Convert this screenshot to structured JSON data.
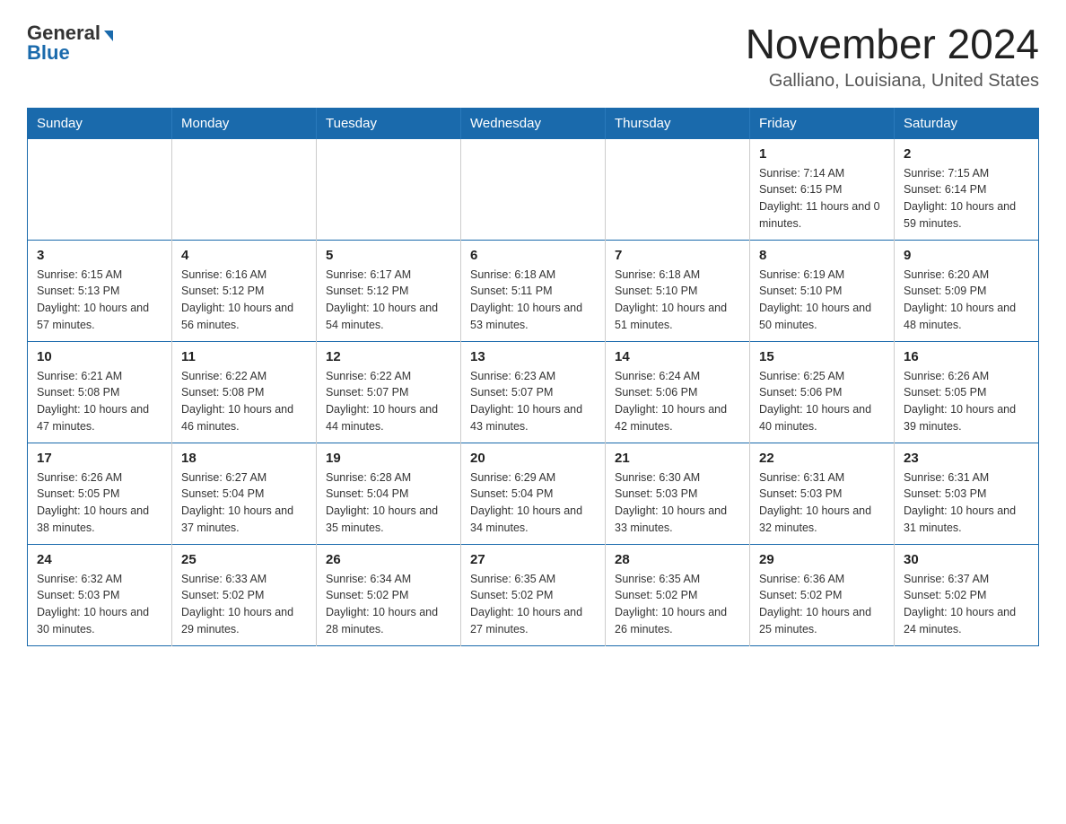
{
  "header": {
    "logo_general": "General",
    "logo_blue": "Blue",
    "month_title": "November 2024",
    "location": "Galliano, Louisiana, United States"
  },
  "days_of_week": [
    "Sunday",
    "Monday",
    "Tuesday",
    "Wednesday",
    "Thursday",
    "Friday",
    "Saturday"
  ],
  "weeks": [
    [
      {
        "day": "",
        "sunrise": "",
        "sunset": "",
        "daylight": ""
      },
      {
        "day": "",
        "sunrise": "",
        "sunset": "",
        "daylight": ""
      },
      {
        "day": "",
        "sunrise": "",
        "sunset": "",
        "daylight": ""
      },
      {
        "day": "",
        "sunrise": "",
        "sunset": "",
        "daylight": ""
      },
      {
        "day": "",
        "sunrise": "",
        "sunset": "",
        "daylight": ""
      },
      {
        "day": "1",
        "sunrise": "Sunrise: 7:14 AM",
        "sunset": "Sunset: 6:15 PM",
        "daylight": "Daylight: 11 hours and 0 minutes."
      },
      {
        "day": "2",
        "sunrise": "Sunrise: 7:15 AM",
        "sunset": "Sunset: 6:14 PM",
        "daylight": "Daylight: 10 hours and 59 minutes."
      }
    ],
    [
      {
        "day": "3",
        "sunrise": "Sunrise: 6:15 AM",
        "sunset": "Sunset: 5:13 PM",
        "daylight": "Daylight: 10 hours and 57 minutes."
      },
      {
        "day": "4",
        "sunrise": "Sunrise: 6:16 AM",
        "sunset": "Sunset: 5:12 PM",
        "daylight": "Daylight: 10 hours and 56 minutes."
      },
      {
        "day": "5",
        "sunrise": "Sunrise: 6:17 AM",
        "sunset": "Sunset: 5:12 PM",
        "daylight": "Daylight: 10 hours and 54 minutes."
      },
      {
        "day": "6",
        "sunrise": "Sunrise: 6:18 AM",
        "sunset": "Sunset: 5:11 PM",
        "daylight": "Daylight: 10 hours and 53 minutes."
      },
      {
        "day": "7",
        "sunrise": "Sunrise: 6:18 AM",
        "sunset": "Sunset: 5:10 PM",
        "daylight": "Daylight: 10 hours and 51 minutes."
      },
      {
        "day": "8",
        "sunrise": "Sunrise: 6:19 AM",
        "sunset": "Sunset: 5:10 PM",
        "daylight": "Daylight: 10 hours and 50 minutes."
      },
      {
        "day": "9",
        "sunrise": "Sunrise: 6:20 AM",
        "sunset": "Sunset: 5:09 PM",
        "daylight": "Daylight: 10 hours and 48 minutes."
      }
    ],
    [
      {
        "day": "10",
        "sunrise": "Sunrise: 6:21 AM",
        "sunset": "Sunset: 5:08 PM",
        "daylight": "Daylight: 10 hours and 47 minutes."
      },
      {
        "day": "11",
        "sunrise": "Sunrise: 6:22 AM",
        "sunset": "Sunset: 5:08 PM",
        "daylight": "Daylight: 10 hours and 46 minutes."
      },
      {
        "day": "12",
        "sunrise": "Sunrise: 6:22 AM",
        "sunset": "Sunset: 5:07 PM",
        "daylight": "Daylight: 10 hours and 44 minutes."
      },
      {
        "day": "13",
        "sunrise": "Sunrise: 6:23 AM",
        "sunset": "Sunset: 5:07 PM",
        "daylight": "Daylight: 10 hours and 43 minutes."
      },
      {
        "day": "14",
        "sunrise": "Sunrise: 6:24 AM",
        "sunset": "Sunset: 5:06 PM",
        "daylight": "Daylight: 10 hours and 42 minutes."
      },
      {
        "day": "15",
        "sunrise": "Sunrise: 6:25 AM",
        "sunset": "Sunset: 5:06 PM",
        "daylight": "Daylight: 10 hours and 40 minutes."
      },
      {
        "day": "16",
        "sunrise": "Sunrise: 6:26 AM",
        "sunset": "Sunset: 5:05 PM",
        "daylight": "Daylight: 10 hours and 39 minutes."
      }
    ],
    [
      {
        "day": "17",
        "sunrise": "Sunrise: 6:26 AM",
        "sunset": "Sunset: 5:05 PM",
        "daylight": "Daylight: 10 hours and 38 minutes."
      },
      {
        "day": "18",
        "sunrise": "Sunrise: 6:27 AM",
        "sunset": "Sunset: 5:04 PM",
        "daylight": "Daylight: 10 hours and 37 minutes."
      },
      {
        "day": "19",
        "sunrise": "Sunrise: 6:28 AM",
        "sunset": "Sunset: 5:04 PM",
        "daylight": "Daylight: 10 hours and 35 minutes."
      },
      {
        "day": "20",
        "sunrise": "Sunrise: 6:29 AM",
        "sunset": "Sunset: 5:04 PM",
        "daylight": "Daylight: 10 hours and 34 minutes."
      },
      {
        "day": "21",
        "sunrise": "Sunrise: 6:30 AM",
        "sunset": "Sunset: 5:03 PM",
        "daylight": "Daylight: 10 hours and 33 minutes."
      },
      {
        "day": "22",
        "sunrise": "Sunrise: 6:31 AM",
        "sunset": "Sunset: 5:03 PM",
        "daylight": "Daylight: 10 hours and 32 minutes."
      },
      {
        "day": "23",
        "sunrise": "Sunrise: 6:31 AM",
        "sunset": "Sunset: 5:03 PM",
        "daylight": "Daylight: 10 hours and 31 minutes."
      }
    ],
    [
      {
        "day": "24",
        "sunrise": "Sunrise: 6:32 AM",
        "sunset": "Sunset: 5:03 PM",
        "daylight": "Daylight: 10 hours and 30 minutes."
      },
      {
        "day": "25",
        "sunrise": "Sunrise: 6:33 AM",
        "sunset": "Sunset: 5:02 PM",
        "daylight": "Daylight: 10 hours and 29 minutes."
      },
      {
        "day": "26",
        "sunrise": "Sunrise: 6:34 AM",
        "sunset": "Sunset: 5:02 PM",
        "daylight": "Daylight: 10 hours and 28 minutes."
      },
      {
        "day": "27",
        "sunrise": "Sunrise: 6:35 AM",
        "sunset": "Sunset: 5:02 PM",
        "daylight": "Daylight: 10 hours and 27 minutes."
      },
      {
        "day": "28",
        "sunrise": "Sunrise: 6:35 AM",
        "sunset": "Sunset: 5:02 PM",
        "daylight": "Daylight: 10 hours and 26 minutes."
      },
      {
        "day": "29",
        "sunrise": "Sunrise: 6:36 AM",
        "sunset": "Sunset: 5:02 PM",
        "daylight": "Daylight: 10 hours and 25 minutes."
      },
      {
        "day": "30",
        "sunrise": "Sunrise: 6:37 AM",
        "sunset": "Sunset: 5:02 PM",
        "daylight": "Daylight: 10 hours and 24 minutes."
      }
    ]
  ]
}
